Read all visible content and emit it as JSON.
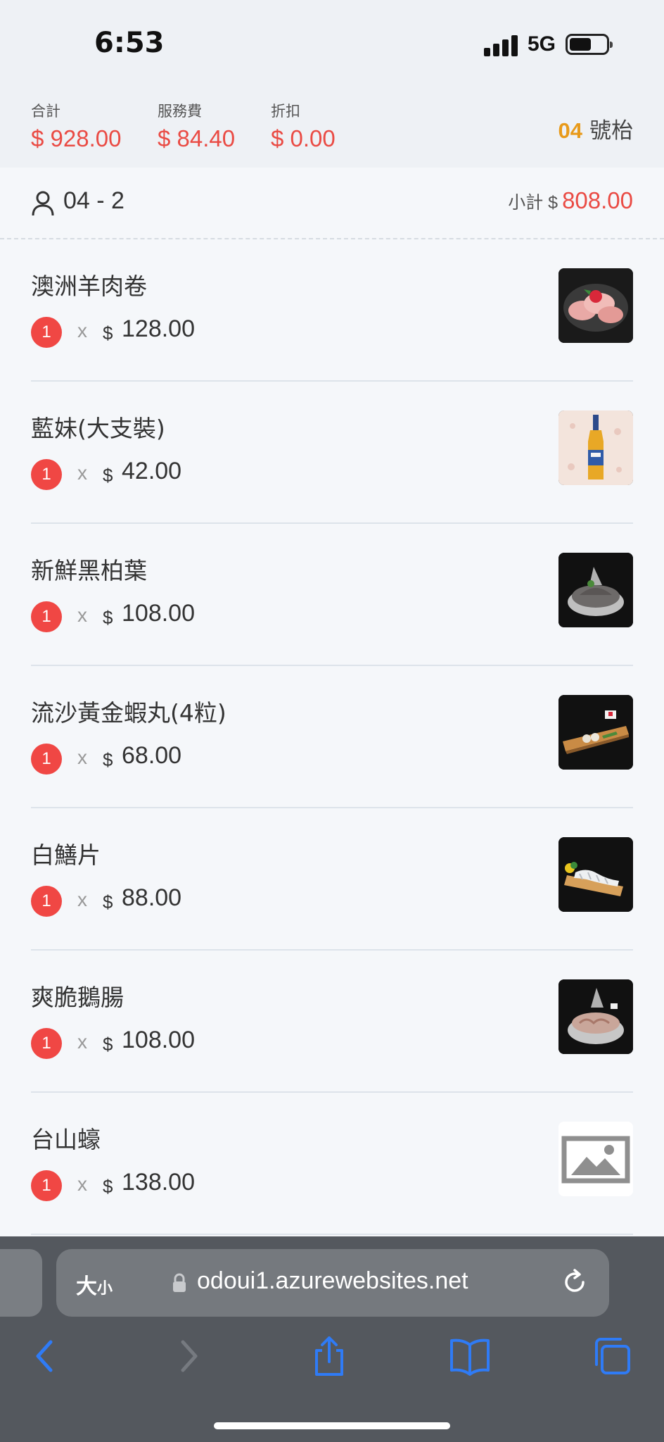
{
  "status_bar": {
    "time": "6:53",
    "network": "5G"
  },
  "summary": {
    "total_label": "合計",
    "total_value": "$ 928.00",
    "service_label": "服務費",
    "service_value": "$ 84.40",
    "discount_label": "折扣",
    "discount_value": "$ 0.00",
    "table_number": "04",
    "table_suffix": "號枱"
  },
  "guest": {
    "id": "04 - 2",
    "subtotal_label": "小計 $",
    "subtotal_value": "808.00"
  },
  "items": [
    {
      "name": "澳洲羊肉卷",
      "qty": "1",
      "times": "x",
      "currency": "$",
      "price": "128.00",
      "image": "lamb-roll"
    },
    {
      "name": "藍妹(大支裝)",
      "qty": "1",
      "times": "x",
      "currency": "$",
      "price": "42.00",
      "image": "beer-bottle"
    },
    {
      "name": "新鮮黑柏葉",
      "qty": "1",
      "times": "x",
      "currency": "$",
      "price": "108.00",
      "image": "tripe-bowl"
    },
    {
      "name": "流沙黃金蝦丸(4粒)",
      "qty": "1",
      "times": "x",
      "currency": "$",
      "price": "68.00",
      "image": "shrimp-balls-board"
    },
    {
      "name": "白鱔片",
      "qty": "1",
      "times": "x",
      "currency": "$",
      "price": "88.00",
      "image": "eel-slices-board"
    },
    {
      "name": "爽脆鵝腸",
      "qty": "1",
      "times": "x",
      "currency": "$",
      "price": "108.00",
      "image": "goose-intestine-bowl"
    },
    {
      "name": "台山蠔",
      "qty": "1",
      "times": "x",
      "currency": "$",
      "price": "138.00",
      "image": "placeholder-image"
    }
  ],
  "browser": {
    "text_size_label": "大",
    "text_size_small": "小",
    "url": "odoui1.azurewebsites.net"
  },
  "colors": {
    "accent_red": "#ea4b44",
    "table_orange": "#e89a1a",
    "ios_blue": "#2f7bf6"
  }
}
